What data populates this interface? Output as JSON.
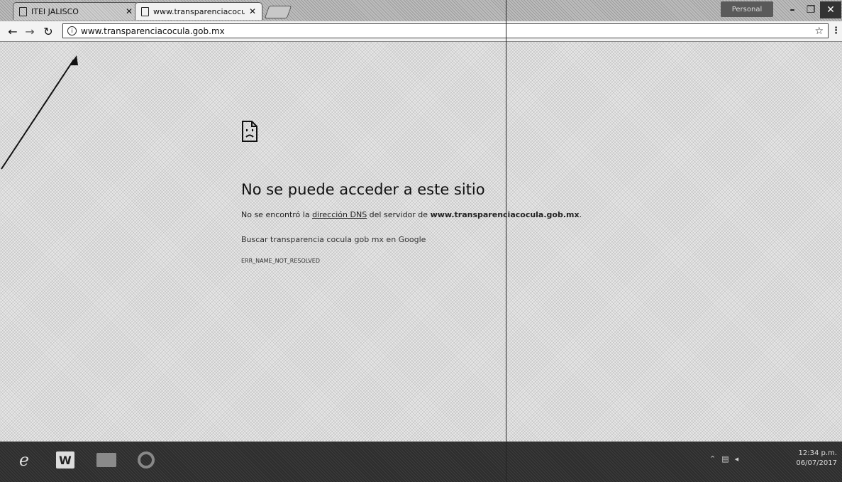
{
  "browser": {
    "tabs": [
      {
        "title": "ITEI JALISCO",
        "active": false
      },
      {
        "title": "www.transparenciacocula",
        "active": true
      }
    ],
    "profile_label": "Personal",
    "toolbar": {
      "url": "www.transparenciacocula.gob.mx"
    }
  },
  "error_page": {
    "title": "No se puede acceder a este sitio",
    "desc_prefix": "No se encontró la ",
    "desc_link": "dirección DNS",
    "desc_middle": " del servidor de ",
    "desc_host": "www.transparenciacocula.gob.mx",
    "desc_suffix": ".",
    "search_text": "Buscar transparencia cocula gob mx en Google",
    "error_code": "ERR_NAME_NOT_RESOLVED"
  },
  "taskbar": {
    "clock_time": "12:34 p.m.",
    "clock_date": "06/07/2017"
  },
  "icons": {
    "tab_page": "page-icon",
    "back": "arrow-left-icon",
    "forward": "arrow-right-icon",
    "reload": "reload-icon",
    "site_info": "info-icon",
    "bookmark": "star-icon",
    "menu": "kebab-menu-icon",
    "error": "sad-page-icon"
  }
}
